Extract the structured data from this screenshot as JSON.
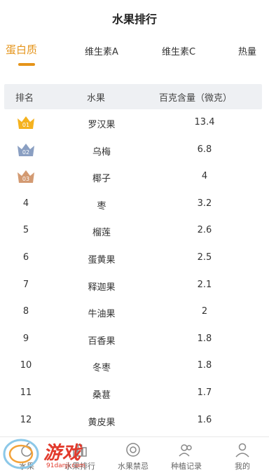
{
  "page_title": "水果排行",
  "tabs": [
    {
      "label": "蛋白质",
      "active": true
    },
    {
      "label": "维生素A",
      "active": false
    },
    {
      "label": "维生素C",
      "active": false
    },
    {
      "label": "热量",
      "active": false
    }
  ],
  "table_header": {
    "rank": "排名",
    "fruit": "水果",
    "amount": "百克含量（微克）"
  },
  "rows": [
    {
      "rank": "01",
      "fruit": "罗汉果",
      "amount": "13.4",
      "crown": "gold"
    },
    {
      "rank": "02",
      "fruit": "乌梅",
      "amount": "6.8",
      "crown": "silver"
    },
    {
      "rank": "03",
      "fruit": "椰子",
      "amount": "4",
      "crown": "bronze"
    },
    {
      "rank": "4",
      "fruit": "枣",
      "amount": "3.2"
    },
    {
      "rank": "5",
      "fruit": "榴莲",
      "amount": "2.6"
    },
    {
      "rank": "6",
      "fruit": "蛋黄果",
      "amount": "2.5"
    },
    {
      "rank": "7",
      "fruit": "释迦果",
      "amount": "2.1"
    },
    {
      "rank": "8",
      "fruit": "牛油果",
      "amount": "2"
    },
    {
      "rank": "9",
      "fruit": "百香果",
      "amount": "1.8"
    },
    {
      "rank": "10",
      "fruit": "冬枣",
      "amount": "1.8"
    },
    {
      "rank": "11",
      "fruit": "桑葚",
      "amount": "1.7"
    },
    {
      "rank": "12",
      "fruit": "黄皮果",
      "amount": "1.6"
    }
  ],
  "colors": {
    "accent": "#e5941a",
    "gold": "#f5b21e",
    "silver": "#8a9fc2",
    "bronze": "#d39a72"
  },
  "bottom_nav": [
    {
      "label": "水果",
      "icon": "fruit-icon"
    },
    {
      "label": "水果排行",
      "icon": "ranking-icon"
    },
    {
      "label": "水果禁忌",
      "icon": "taboo-icon"
    },
    {
      "label": "种植记录",
      "icon": "planting-record-icon"
    },
    {
      "label": "我的",
      "icon": "profile-icon"
    }
  ],
  "watermark": {
    "text": "游戏",
    "sub": "91danji.com"
  }
}
